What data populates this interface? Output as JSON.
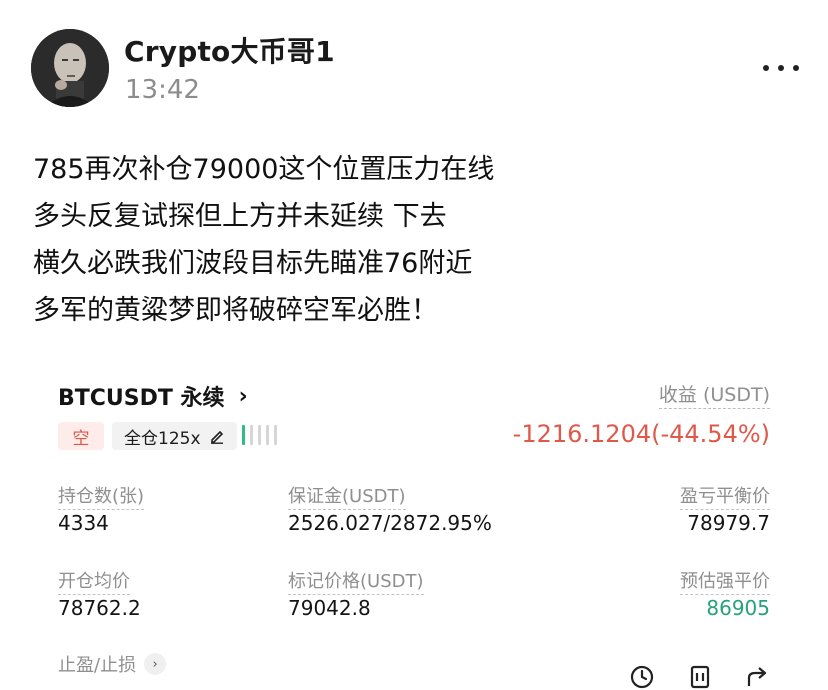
{
  "post": {
    "author": "Crypto大币哥1",
    "time": "13:42",
    "lines": [
      "785再次补仓79000这个位置压力在线",
      "多头反复试探但上方并未延续 下去",
      "横久必跌我们波段目标先瞄准76附近",
      "多军的黄粱梦即将破碎空军必胜！"
    ]
  },
  "position_card": {
    "symbol": "BTCUSDT 永续",
    "chevron": "›",
    "side": "空",
    "margin_mode": "全仓125x",
    "pnl_label": "收益 (USDT)",
    "pnl_value": "-1216.1204(-44.54%)",
    "stats": {
      "size_label": "持仓数(张)",
      "size_value": "4334",
      "margin_label": "保证金(USDT)",
      "margin_value": "2526.027/2872.95%",
      "breakeven_label": "盈亏平衡价",
      "breakeven_value": "78979.7",
      "entry_label": "开仓均价",
      "entry_value": "78762.2",
      "mark_label": "标记价格(USDT)",
      "mark_value": "79042.8",
      "liq_label": "预估强平价",
      "liq_value": "86905"
    },
    "tpsl_label": "止盈/止损",
    "colors": {
      "loss": "#e0584a",
      "liq": "#26a17b",
      "short_bg": "#fdecea"
    }
  },
  "icons": [
    "avatar",
    "more-icon",
    "chevron-right-icon",
    "edit-icon",
    "risk-meter",
    "clock-icon",
    "share-card-icon",
    "share-icon"
  ]
}
